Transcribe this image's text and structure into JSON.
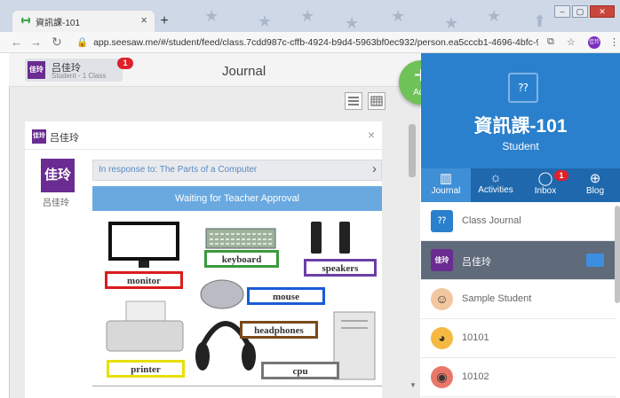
{
  "browser": {
    "tab_title": "資訊課-101",
    "new_tab": "+",
    "url": "app.seesaw.me/#/student/feed/class.7cdd987c-cffb-4924-b9d4-5963bf0ec932/person.ea5cccb1-4696-4bfc-93d8-ea0...",
    "profile_initials": "佳玲"
  },
  "header": {
    "user_initials": "佳玲",
    "user_name": "吕佳玲",
    "user_role": "Student - 1 Class",
    "notification_count": "1",
    "title": "Journal"
  },
  "add_button": {
    "label": "Add"
  },
  "post": {
    "author_initials": "佳玲",
    "author_name": "吕佳玲",
    "close": "×",
    "avatar_name": "吕佳玲",
    "response_text": "In response to: The Parts of a Computer",
    "status": "Waiting for Teacher Approval",
    "labels": [
      "monitor",
      "keyboard",
      "speakers",
      "mouse",
      "printer",
      "headphones",
      "cpu"
    ]
  },
  "class_panel": {
    "icon": "⁇",
    "title": "資訊課-101",
    "subtitle": "Student",
    "tabs": [
      {
        "label": "Journal",
        "icon": "book-icon"
      },
      {
        "label": "Activities",
        "icon": "lightbulb-icon"
      },
      {
        "label": "Inbox",
        "icon": "chat-icon",
        "badge": "1"
      },
      {
        "label": "Blog",
        "icon": "globe-icon"
      }
    ],
    "list": [
      {
        "label": "Class Journal",
        "icon": "⁇"
      },
      {
        "label": "吕佳玲",
        "icon": "佳玲"
      },
      {
        "label": "Sample Student",
        "icon": "student-avatar"
      },
      {
        "label": "10101",
        "icon": "tiger-avatar"
      },
      {
        "label": "10102",
        "icon": "octopus-avatar"
      }
    ]
  },
  "colors": {
    "accent": "#2a80cc",
    "add": "#6ec257",
    "badge": "#e0202b",
    "avatar": "#6a2c91"
  }
}
